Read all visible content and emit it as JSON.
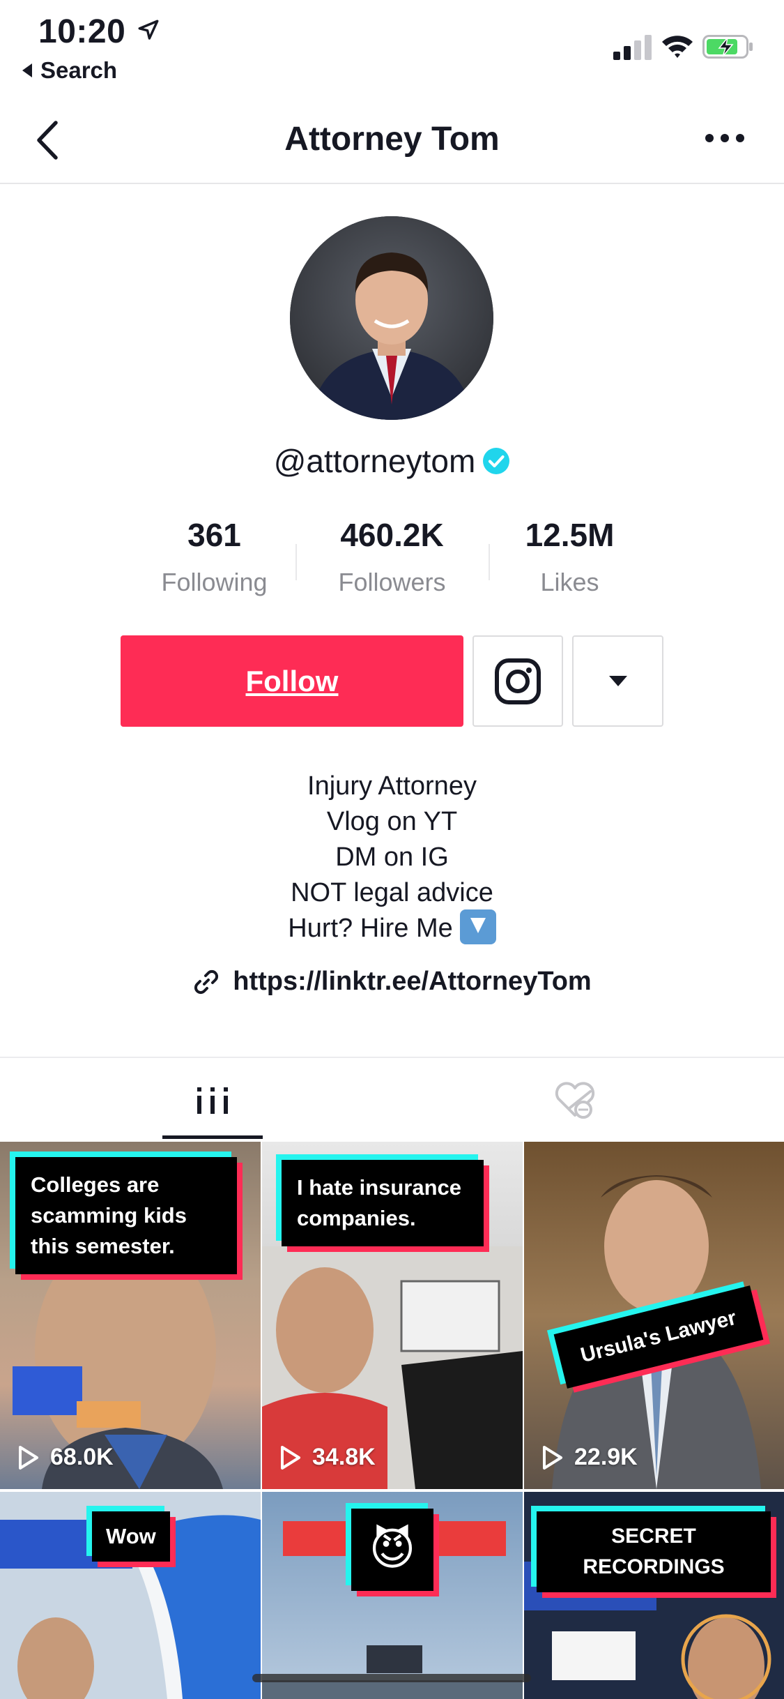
{
  "status": {
    "time": "10:20",
    "back_label": "Search"
  },
  "nav": {
    "title": "Attorney Tom"
  },
  "profile": {
    "username": "@attorneytom",
    "stats": [
      {
        "value": "361",
        "label": "Following"
      },
      {
        "value": "460.2K",
        "label": "Followers"
      },
      {
        "value": "12.5M",
        "label": "Likes"
      }
    ],
    "follow_label": "Follow",
    "bio_lines": [
      "Injury Attorney",
      "Vlog on YT",
      "DM on IG",
      "NOT legal advice",
      "Hurt? Hire Me"
    ],
    "link": "https://linktr.ee/AttorneyTom"
  },
  "videos": [
    {
      "caption": "Colleges are scamming kids this semester.",
      "views": "68.0K"
    },
    {
      "caption": "I hate insurance companies.",
      "views": "34.8K"
    },
    {
      "caption": "Ursula's Lawyer",
      "views": "22.9K"
    },
    {
      "caption": "Wow",
      "views": ""
    },
    {
      "caption": "😈",
      "views": ""
    },
    {
      "caption": "SECRET RECORDINGS",
      "views": ""
    }
  ],
  "colors": {
    "accent": "#fe2c55",
    "verified": "#20d5ec",
    "cyan": "#25f4ee"
  }
}
